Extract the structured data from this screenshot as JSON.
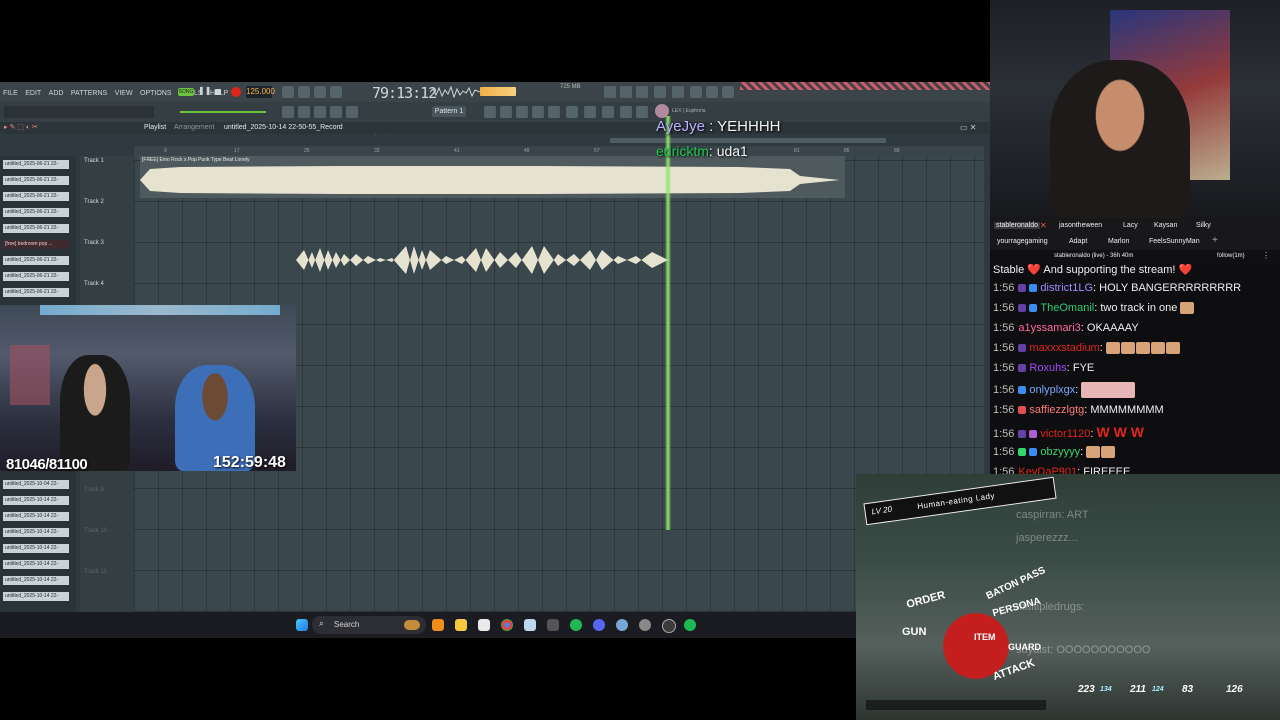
{
  "fl": {
    "menu": [
      "FILE",
      "EDIT",
      "ADD",
      "PATTERNS",
      "VIEW",
      "OPTIONS",
      "TOOLS",
      "HELP"
    ],
    "song_badge": "SONG",
    "tempo": "125.000",
    "timecode": "79:13:12",
    "memory": "725 MB",
    "none_select": "(none)",
    "pattern": "Pattern 1",
    "plugin_label": "LEX | Euphoria",
    "playlist_title": "Playlist",
    "playlist_sub": "Arrangement",
    "project_name": "untitled_2025-10-14 22-50-55_Record",
    "clip_title": "[FREE] Emo Rock x Pop Punk Type Beat Lonely",
    "tracks": [
      "Track 1",
      "Track 2",
      "Track 3",
      "Track 4",
      "Track 9",
      "Track 10",
      "Track 11"
    ],
    "browser_top": [
      "untitled_2025-06-21 22-",
      "untitled_2025-06-21 22-",
      "untitled_2025-06-21 22-",
      "untitled_2025-06-21 22-",
      "untitled_2025-06-21 22-",
      "[free] bedroom pop ...",
      "untitled_2025-06-21 22-",
      "untitled_2025-06-21 22-",
      "untitled_2025-06-21 22-"
    ],
    "browser_bottom": [
      "untitled_2025-10-04 22-",
      "untitled_2025-10-14 22-",
      "untitled_2025-10-14 22-",
      "untitled_2025-10-14 22-",
      "untitled_2025-10-14 22-",
      "untitled_2025-10-14 22-",
      "untitled_2025-10-14 22-",
      "untitled_2025-10-14 22-"
    ],
    "ruler": [
      "9",
      "17",
      "25",
      "33",
      "41",
      "49",
      "57",
      "65",
      "73",
      "81",
      "85",
      "89"
    ]
  },
  "overlay_chat": [
    {
      "name": "AyeJye",
      "sep": " : ",
      "text": "YEHHHH"
    },
    {
      "name": "edricktm",
      "sep": ": ",
      "text": "uda1"
    }
  ],
  "reaction": {
    "sub_count": "81046/81100",
    "timer": "152:59:48"
  },
  "taskbar": {
    "search": "Search"
  },
  "twitch": {
    "tabs_row1": [
      "stableronaldo",
      "jasontheween",
      "Lacy",
      "Kaysan",
      "Silky"
    ],
    "tabs_row2": [
      "yourragegaming",
      "Adapt",
      "Marlon",
      "FeelsSunnyMan"
    ],
    "channel_status": "stableronaldo (live) - 36h 40m",
    "follow_mode": "follow(1m)",
    "partial_top": "Stable ❤️ And supporting the stream! ❤️",
    "messages": [
      {
        "time": "1:56",
        "user": "district1LG",
        "color": "#9b8cff",
        "text": "HOLY BANGERRRRRRRRR"
      },
      {
        "time": "1:56",
        "user": "TheOmanil",
        "color": "#2ecc71",
        "text": "two track in one"
      },
      {
        "time": "1:56",
        "user": "a1yssamari3",
        "color": "#ff6b9d",
        "text": "OKAAAAY"
      },
      {
        "time": "1:56",
        "user": "maxxxstadium",
        "color": "#e0261b",
        "text": ""
      },
      {
        "time": "1:56",
        "user": "Roxuhs",
        "color": "#a04cff",
        "text": "FYE"
      },
      {
        "time": "1:56",
        "user": "onlyplxgx",
        "color": "#7aa8ff",
        "text": ""
      },
      {
        "time": "1:56",
        "user": "saffiezzlgtg",
        "color": "#ff7b7b",
        "text": "MMMMMMMM"
      },
      {
        "time": "1:56",
        "user": "victor1120",
        "color": "#e0261b",
        "text": "W W W"
      },
      {
        "time": "1:56",
        "user": "obzyyyy",
        "color": "#36d66b",
        "text": ""
      },
      {
        "time": "1:56",
        "user": "KeyDaP901",
        "color": "#e0261b",
        "text": "FIREEEE"
      }
    ]
  },
  "game": {
    "level": "LV 20",
    "enemy": "Human-eating Lady",
    "commands": [
      "ORDER",
      "GUN",
      "ITEM",
      "BATON PASS",
      "PERSONA",
      "GUARD",
      "ATTACK"
    ],
    "hp": [
      "223",
      "134",
      "211",
      "124",
      "83",
      "126"
    ],
    "ghost_chat": [
      "caspirran: ART",
      "jasperezzz...",
      "multipledrugs:",
      "suyaist: OOOOOOOOOOO"
    ]
  },
  "colors": {
    "playhead": "#8ee86a",
    "record": "#e0261b",
    "tempo_text": "#f3b04a"
  }
}
